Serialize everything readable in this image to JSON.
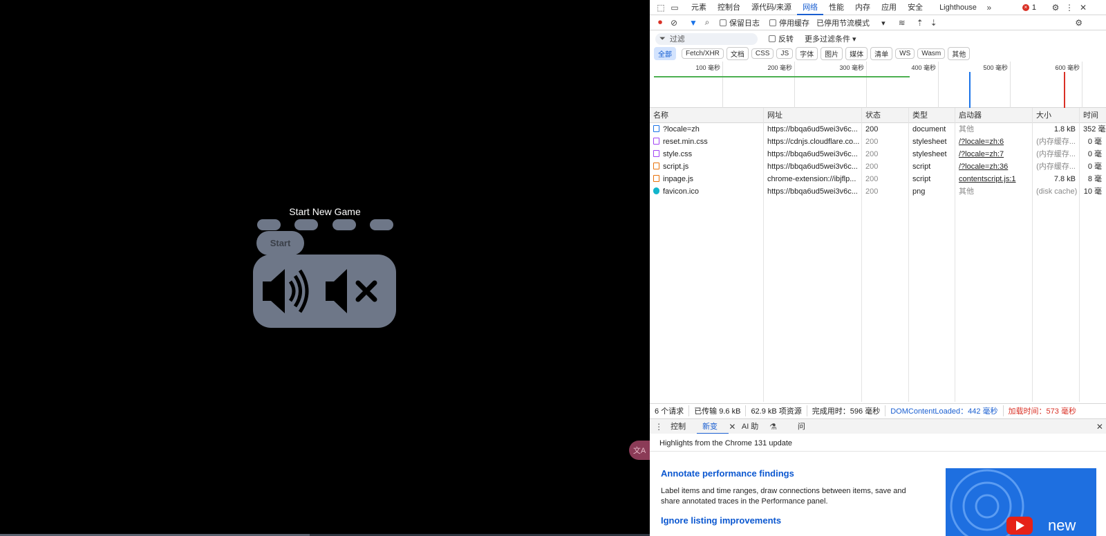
{
  "game": {
    "title": "Start New Game",
    "start_label": "Start"
  },
  "translate_badge": "文A",
  "devtools": {
    "tabs": [
      "元素",
      "控制台",
      "源代码/来源",
      "网络",
      "性能",
      "内存",
      "应用",
      "安全",
      "Lighthouse"
    ],
    "error_count": "1",
    "controls": {
      "preserve_log": "保留日志",
      "disable_cache": "停用缓存",
      "throttle": "已停用节流模式"
    },
    "filter": {
      "placeholder": "过滤",
      "invert": "反转",
      "more": "更多过滤条件"
    },
    "chips": [
      "全部",
      "Fetch/XHR",
      "文档",
      "CSS",
      "JS",
      "字体",
      "图片",
      "媒体",
      "清单",
      "WS",
      "Wasm",
      "其他"
    ],
    "timeline_ticks": [
      "100 毫秒",
      "200 毫秒",
      "300 毫秒",
      "400 毫秒",
      "500 毫秒",
      "600 毫秒"
    ],
    "columns": [
      "名称",
      "网址",
      "状态",
      "类型",
      "启动器",
      "大小",
      "时间"
    ],
    "rows": [
      {
        "name": "?locale=zh",
        "url": "https://bbqa6ud5wei3v6c...",
        "status": "200",
        "type": "document",
        "initiator": "其他",
        "size": "1.8 kB",
        "time": "352 毫",
        "icon_color": "#1a73e8"
      },
      {
        "name": "reset.min.css",
        "url": "https://cdnjs.cloudflare.co...",
        "status": "200",
        "type": "stylesheet",
        "initiator": "/?locale=zh:6",
        "size": "(内存缓存...",
        "time": "0 毫",
        "icon_color": "#a142f4"
      },
      {
        "name": "style.css",
        "url": "https://bbqa6ud5wei3v6c...",
        "status": "200",
        "type": "stylesheet",
        "initiator": "/?locale=zh:7",
        "size": "(内存缓存...",
        "time": "0 毫",
        "icon_color": "#a142f4"
      },
      {
        "name": "script.js",
        "url": "https://bbqa6ud5wei3v6c...",
        "status": "200",
        "type": "script",
        "initiator": "/?locale=zh:36",
        "size": "(内存缓存...",
        "time": "0 毫",
        "icon_color": "#e8710a"
      },
      {
        "name": "inpage.js",
        "url": "chrome-extension://ibjflp...",
        "status": "200",
        "type": "script",
        "initiator": "contentscript.js:1",
        "size": "7.8 kB",
        "time": "8 毫",
        "icon_color": "#e8710a"
      },
      {
        "name": "favicon.ico",
        "url": "https://bbqa6ud5wei3v6c...",
        "status": "200",
        "type": "png",
        "initiator": "其他",
        "size": "(disk cache)",
        "time": "10 毫",
        "icon_color": "#12b5cb"
      }
    ],
    "status_bar": {
      "requests": "6 个请求",
      "transferred": "已传输 9.6 kB",
      "resources": "62.9 kB 项资源",
      "finish": "完成用时：596 毫秒",
      "dcl": "DOMContentLoaded：442 毫秒",
      "load": "加载时间：573 毫秒"
    },
    "drawer": {
      "tabs": [
        "控制台",
        "新变化",
        "AI 助理",
        "问题"
      ],
      "headline": "Highlights from the Chrome 131 update",
      "article1_title": "Annotate performance findings",
      "article1_body": "Label items and time ranges, draw connections between items, save and share annotated traces in the Performance panel.",
      "article2_title": "Ignore listing improvements",
      "video_label": "new"
    }
  }
}
